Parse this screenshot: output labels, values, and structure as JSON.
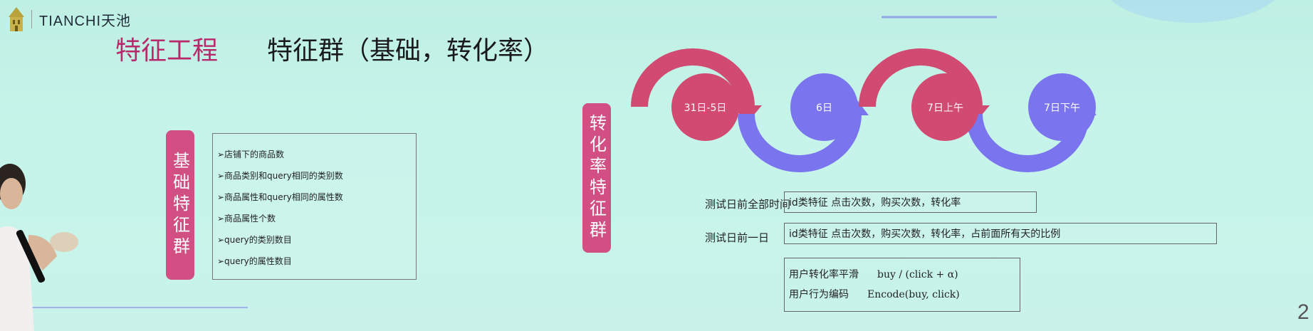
{
  "logo": {
    "text": "TIANCHI天池",
    "icon": "building-icon"
  },
  "title": {
    "main": "特征工程",
    "sub": "特征群（基础，转化率）"
  },
  "basic_group": {
    "label": "基础特征群",
    "items": [
      "➢店铺下的商品数",
      "➢商品类别和query相同的类别数",
      "➢商品属性和query相同的属性数",
      "➢商品属性个数",
      "➢query的类别数目",
      "➢query的属性数目"
    ]
  },
  "conversion_group": {
    "label": "转化率特征群"
  },
  "timeline": {
    "nodes": [
      "31日-5日",
      "6日",
      "7日上午",
      "7日下午"
    ],
    "colors": {
      "red": "#d14a71",
      "blue": "#7a74ee",
      "pill": "#d14f83",
      "title": "#b8296b"
    }
  },
  "rows": [
    {
      "label": "测试日前全部时间",
      "content": "id类特征 点击次数，购买次数，转化率"
    },
    {
      "label": "测试日前一日",
      "content": "id类特征 点击次数，购买次数，转化率，占前面所有天的比例"
    }
  ],
  "formulas": [
    {
      "label": "用户转化率平滑",
      "math": "buy / (click + α)"
    },
    {
      "label": "用户行为编码",
      "math": "Encode(buy, click)"
    }
  ],
  "page_number": "2"
}
